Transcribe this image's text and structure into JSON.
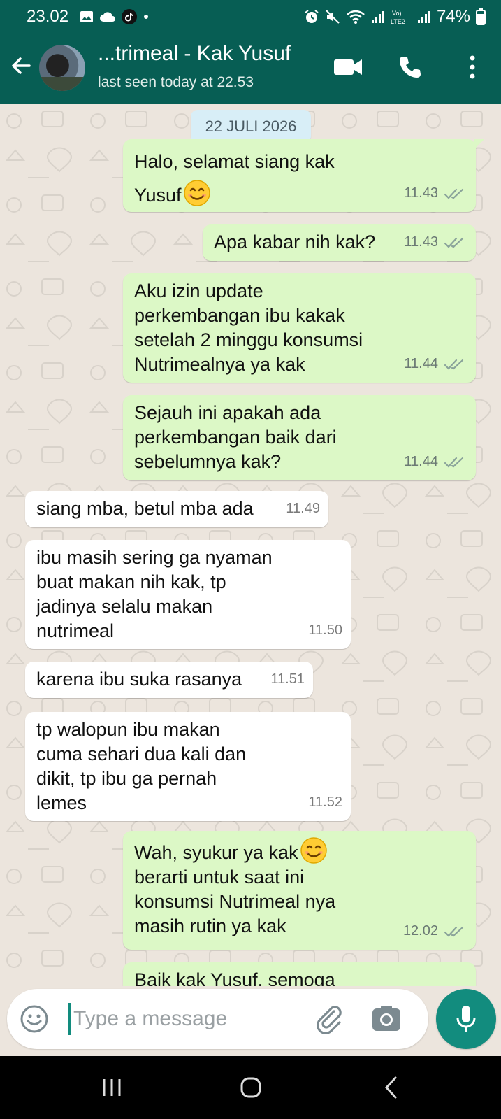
{
  "status_bar": {
    "time": "23.02",
    "battery": "74%"
  },
  "header": {
    "contact_name": "...trimeal - Kak Yusuf",
    "last_seen": "last seen today at 22.53"
  },
  "chat": {
    "date_chip": "22 JULI 2026",
    "messages": [
      {
        "dir": "out",
        "text": "Halo, selamat siang kak\nYusuf",
        "emoji": "smiling-face",
        "time": "11.43"
      },
      {
        "dir": "out",
        "text": "Apa kabar nih kak?",
        "time": "11.43"
      },
      {
        "dir": "out",
        "text": "Aku izin update\nperkembangan ibu kakak\nsetelah 2 minggu konsumsi\nNutrimealnya ya kak",
        "time": "11.44"
      },
      {
        "dir": "out",
        "text": "Sejauh ini apakah ada\nperkembangan baik dari\nsebelumnya kak?",
        "time": "11.44"
      },
      {
        "dir": "in",
        "text": "siang mba, betul mba ada",
        "time": "11.49"
      },
      {
        "dir": "in",
        "text": "ibu masih sering ga nyaman\nbuat makan nih kak, tp\njadinya selalu makan\nnutrimeal",
        "time": "11.50"
      },
      {
        "dir": "in",
        "text": "karena ibu suka rasanya",
        "time": "11.51"
      },
      {
        "dir": "in",
        "text": "tp walopun ibu makan\ncuma sehari dua kali dan\ndikit, tp ibu ga pernah\nlemes",
        "time": "11.52"
      },
      {
        "dir": "out",
        "text": "Wah, syukur ya kak",
        "emoji": "smiling-face",
        "text_after": "berarti untuk saat ini\nkonsumsi Nutrimeal nya\nmasih rutin ya kak",
        "time": "12.02"
      },
      {
        "dir": "out",
        "text": "Baik kak Yusuf, semoga",
        "time": ""
      }
    ]
  },
  "input": {
    "placeholder": "Type a message"
  },
  "colors": {
    "header": "#075e54",
    "outgoing_bubble": "#dcf8c6",
    "incoming_bubble": "#ffffff",
    "accent": "#128c7e",
    "chat_background": "#ece5dd"
  }
}
